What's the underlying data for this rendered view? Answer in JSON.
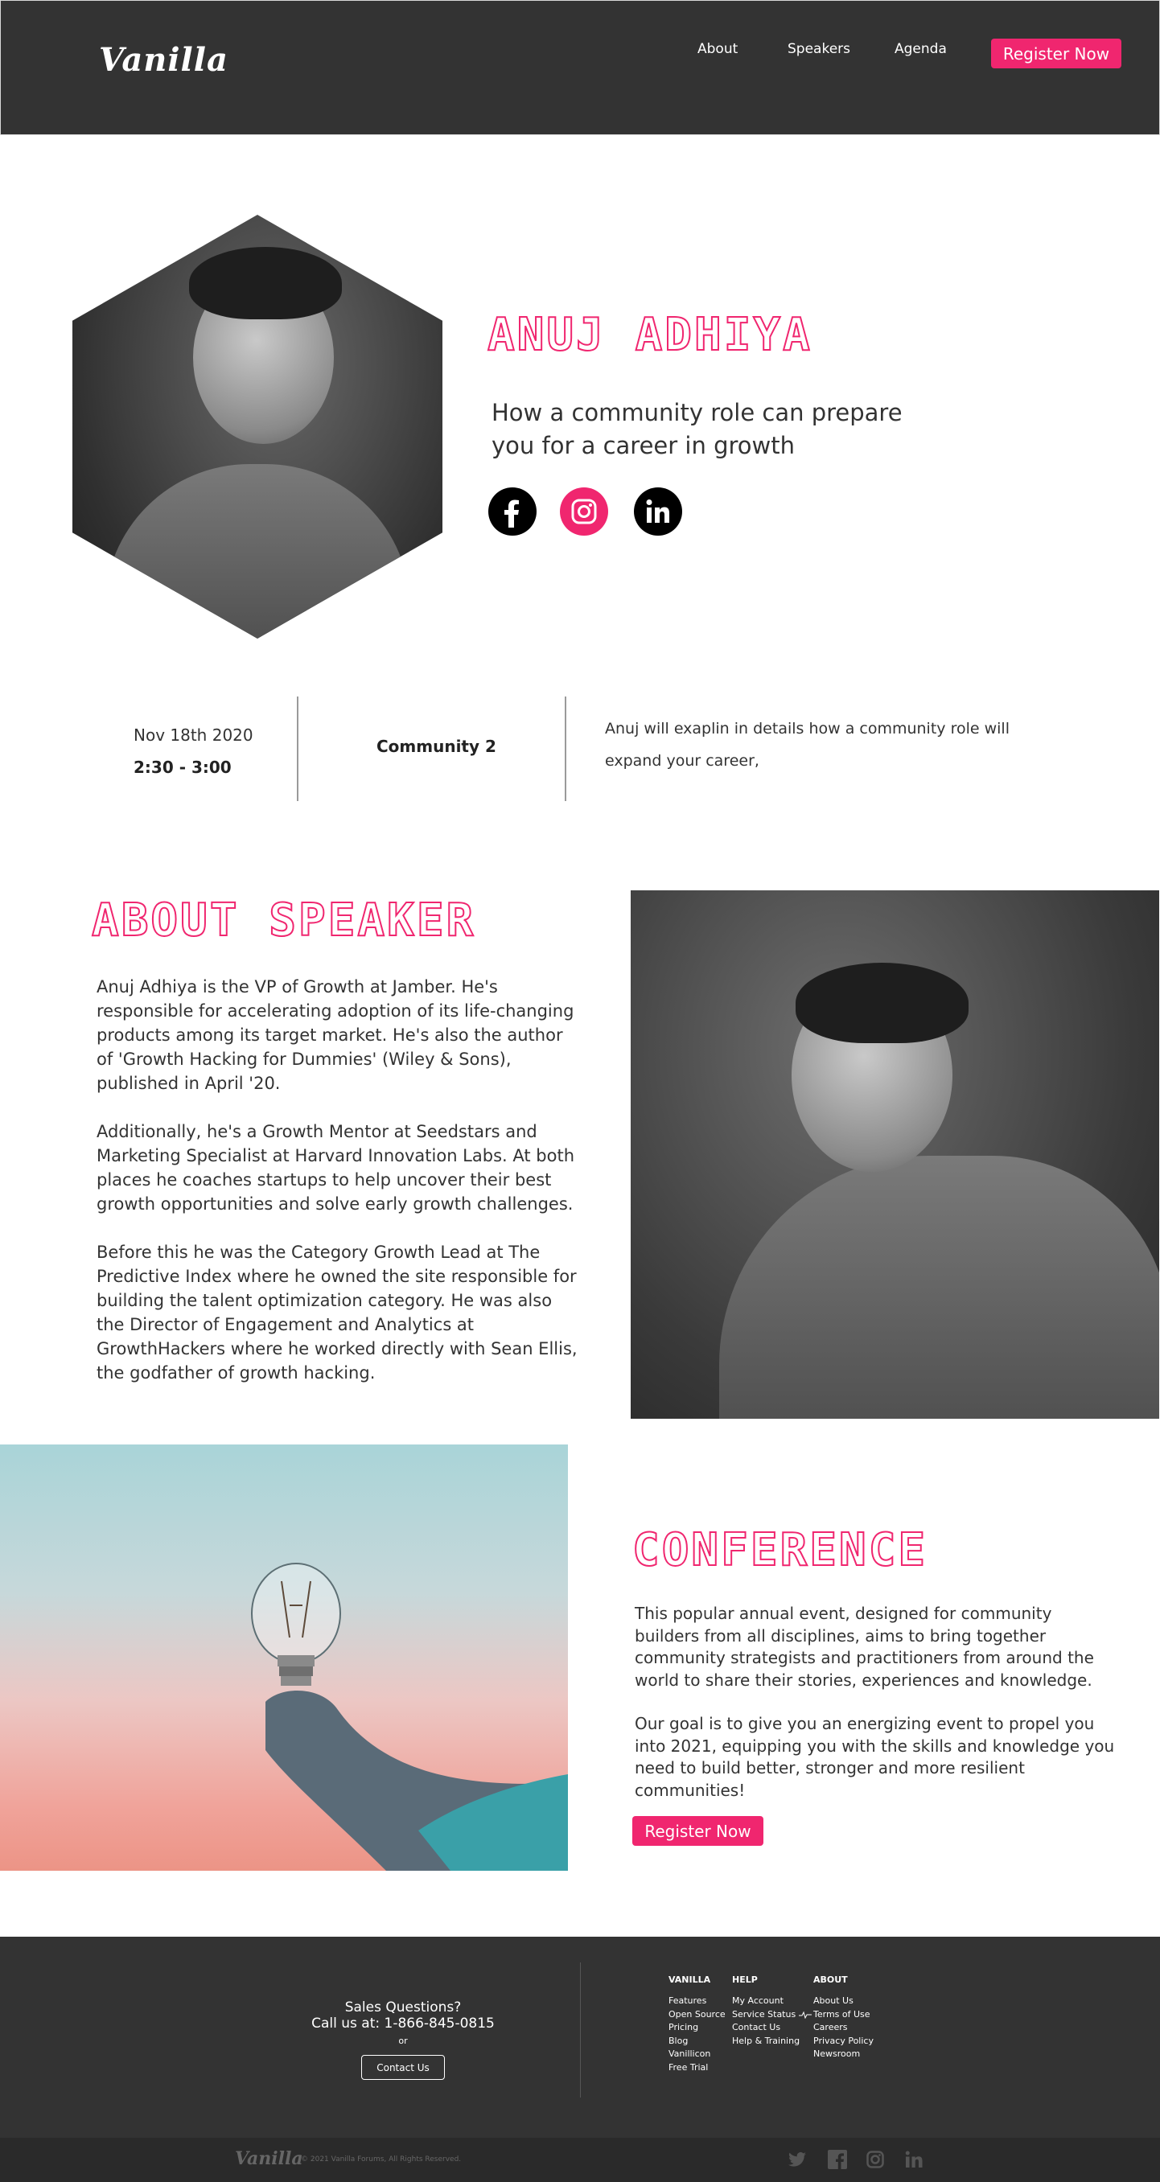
{
  "header": {
    "logo": "Vanilla",
    "nav": [
      "About",
      "Speakers",
      "Agenda"
    ],
    "cta": "Register Now"
  },
  "speaker": {
    "name": "ANUJ ADHIYA",
    "talk_title_line1": "How a community role can prepare",
    "talk_title_line2": "you for a career in growth",
    "socials": [
      "facebook-icon",
      "instagram-icon",
      "linkedin-icon"
    ]
  },
  "session": {
    "date": "Nov 18th 2020",
    "time": "2:30 - 3:00",
    "track": "Community 2",
    "description_line1": "Anuj will exaplin in details how a community role will",
    "description_line2": "expand your career,"
  },
  "about": {
    "heading": "ABOUT SPEAKER",
    "p1": "Anuj Adhiya is the VP of Growth at Jamber. He's responsible for accelerating adoption of its life-changing products among its target market. He's also the author of 'Growth Hacking for Dummies' (Wiley & Sons), published in April '20.",
    "p2": "Additionally, he's a Growth Mentor at Seedstars and Marketing Specialist at Harvard Innovation Labs. At both places he coaches startups to help uncover their best growth opportunities and solve early growth challenges.",
    "p3": "Before this he was the Category Growth Lead at The Predictive Index where he owned the site responsible for building the talent optimization category. He was also the Director of Engagement and Analytics at GrowthHackers where he worked directly with Sean Ellis, the godfather of growth hacking."
  },
  "conference": {
    "heading": "CONFERENCE",
    "p1": "This popular annual event, designed for community builders from all disciplines, aims to bring together community strategists and practitioners from around the world to share their stories, experiences and knowledge.",
    "p2": "Our goal is to give you an energizing event to propel you into 2021, equipping you with the skills and knowledge you need to build better, stronger and more resilient communities!",
    "cta": "Register Now"
  },
  "footer": {
    "sales_title": "Sales Questions?",
    "sales_phone": "Call us at: 1-866-845-0815",
    "or": "or",
    "contact_button": "Contact Us",
    "columns": [
      {
        "title": "VANILLA",
        "links": [
          "Features",
          "Open Source",
          "Pricing",
          "Blog",
          "Vanillicon",
          "Free Trial"
        ]
      },
      {
        "title": "HELP",
        "links": [
          "My Account",
          "Service Status",
          "Contact Us",
          "Help & Training"
        ]
      },
      {
        "title": "ABOUT",
        "links": [
          "About Us",
          "Terms of Use",
          "Careers",
          "Privacy Policy",
          "Newsroom"
        ]
      }
    ],
    "bottom_logo": "Vanilla",
    "copyright": "© 2021 Vanilla Forums, All Rights Reserved.",
    "bottom_icons": [
      "twitter-icon",
      "facebook-icon",
      "instagram-icon",
      "linkedin-icon"
    ]
  },
  "colors": {
    "accent": "#f0266f",
    "dark": "#333333"
  }
}
